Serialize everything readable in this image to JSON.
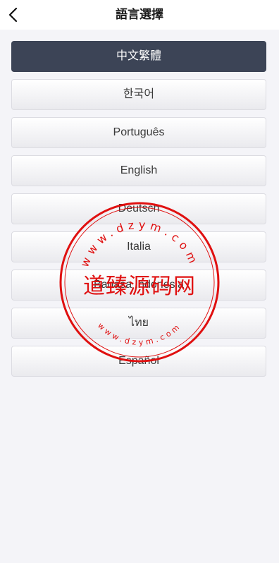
{
  "header": {
    "title": "語言選擇",
    "back_icon": "chevron-left-icon"
  },
  "languages": [
    {
      "label": "中文繁體",
      "selected": true
    },
    {
      "label": "한국어",
      "selected": false
    },
    {
      "label": "Português",
      "selected": false
    },
    {
      "label": "English",
      "selected": false
    },
    {
      "label": "Deutsch",
      "selected": false
    },
    {
      "label": "Italia",
      "selected": false
    },
    {
      "label": "Bahasa Indonesia",
      "selected": false
    },
    {
      "label": "ไทย",
      "selected": false
    },
    {
      "label": "Español",
      "selected": false
    }
  ],
  "watermark": {
    "brand": "道臻源码网",
    "url_top": "www.dzym.com",
    "url_bottom": "www.dzym.com",
    "color": "#e01010"
  },
  "colors": {
    "selected_bg": "#3c4456",
    "page_bg": "#f4f4f8"
  }
}
